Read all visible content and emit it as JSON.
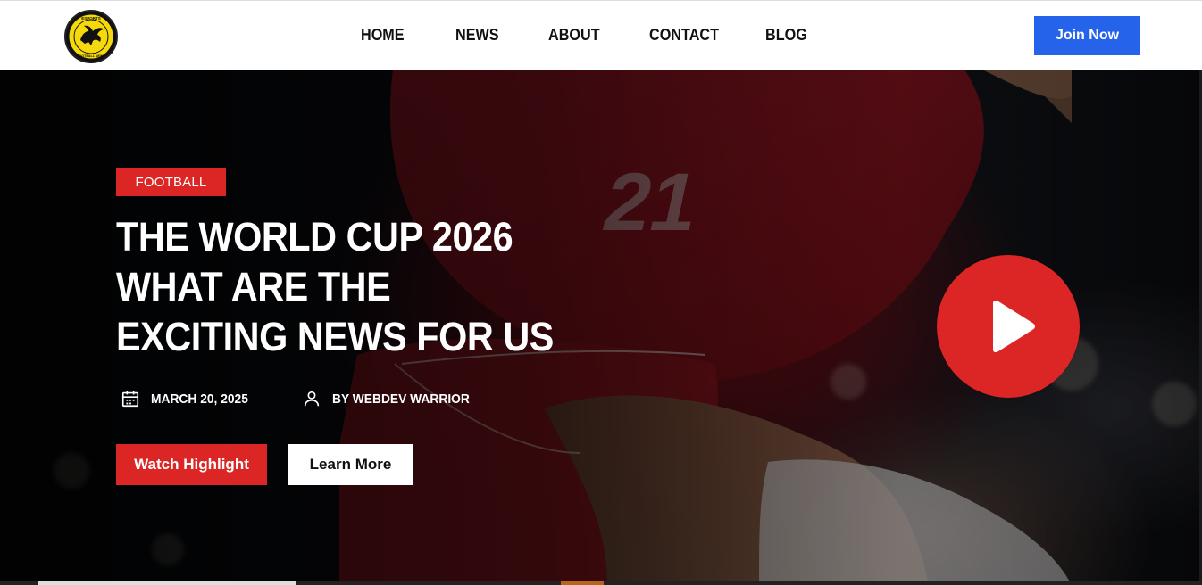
{
  "header": {
    "logo_icon": "pegasus-crest-logo-icon",
    "logo_text": "ESPORTS FOOTBALL NEWS",
    "nav": [
      {
        "label": "HOME"
      },
      {
        "label": "NEWS"
      },
      {
        "label": "ABOUT"
      },
      {
        "label": "CONTACT"
      },
      {
        "label": "BLOG"
      }
    ],
    "join_label": "Join Now",
    "join_color": "#2563eb"
  },
  "hero": {
    "category_tag": "FOOTBALL",
    "headline": "THE WORLD CUP 2026 WHAT ARE THE EXCITING NEWS FOR US",
    "date": "MARCH 20, 2025",
    "date_icon": "calendar-icon",
    "author": "BY WEBDEV WARRIOR",
    "author_icon": "user-icon",
    "watch_label": "Watch Highlight",
    "learn_label": "Learn More",
    "play_icon": "play-icon",
    "accent_color": "#dc2626",
    "jersey_number": "21"
  }
}
